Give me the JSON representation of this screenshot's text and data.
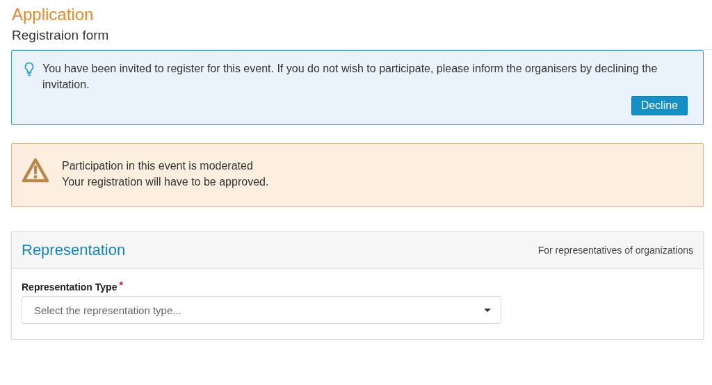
{
  "page": {
    "title": "Application",
    "subtitle": "Registraion form"
  },
  "alerts": [
    {
      "kind": "info",
      "lines": [
        "You have been invited to register for this event. If you do not wish to participate, please inform the organisers by declining the invitation."
      ],
      "button": "Decline"
    },
    {
      "kind": "warning",
      "lines": [
        "Participation in this event is moderated",
        "Your registration will have to be approved."
      ]
    }
  ],
  "panel": {
    "title": "Representation",
    "note": "For representatives of organizations",
    "field": {
      "label": "Representation Type",
      "required": true,
      "required_mark": "*",
      "placeholder": "Select the representation type..."
    }
  }
}
